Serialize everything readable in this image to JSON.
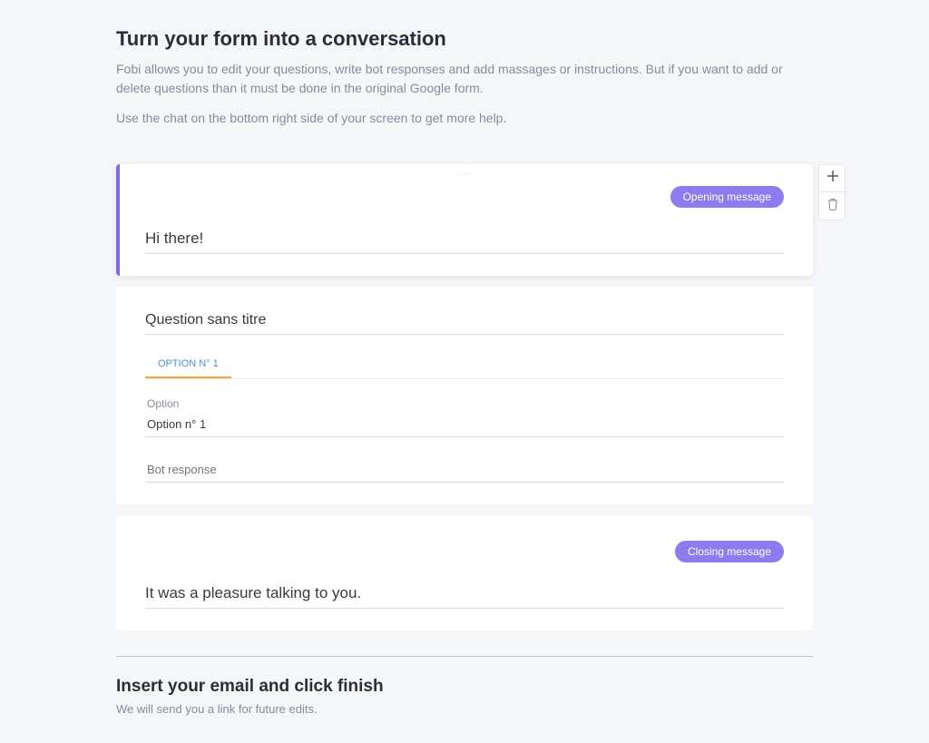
{
  "header": {
    "title": "Turn your form into a conversation",
    "description": "Fobi allows you to edit your questions, write bot responses and add massages or instructions. But if you want to add or delete questions than it must be done in the original Google form.",
    "help_line": "Use the chat on the bottom right side of your screen to get more help."
  },
  "opening": {
    "badge": "Opening message",
    "text": "Hi there!"
  },
  "question": {
    "title": "Question sans titre",
    "tab_label": "OPTION N° 1",
    "option_label": "Option",
    "option_value": "Option n° 1",
    "bot_response_placeholder": "Bot response"
  },
  "closing": {
    "badge": "Closing message",
    "text": "It was a pleasure talking to you."
  },
  "email_section": {
    "title": "Insert your email and click finish",
    "description": "We will send you a link for future edits."
  },
  "toolbar": {
    "add": "+",
    "delete": "delete"
  }
}
